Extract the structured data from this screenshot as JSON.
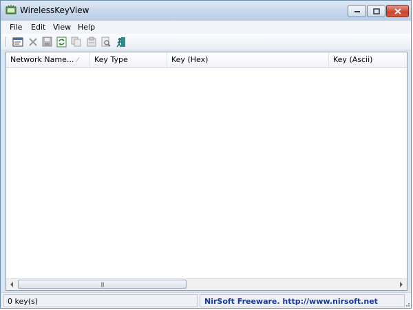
{
  "window": {
    "title": "WirelessKeyView"
  },
  "menu": [
    {
      "label": "File"
    },
    {
      "label": "Edit"
    },
    {
      "label": "View"
    },
    {
      "label": "Help"
    }
  ],
  "toolbar": {
    "icons": [
      "properties-icon",
      "delete-icon",
      "save-icon",
      "refresh-icon",
      "copy-icon",
      "html-report-icon",
      "find-icon",
      "exit-icon"
    ]
  },
  "list": {
    "columns": [
      {
        "label": "Network Name..."
      },
      {
        "label": "Key Type"
      },
      {
        "label": "Key (Hex)"
      },
      {
        "label": "Key (Ascii)"
      }
    ],
    "rows": []
  },
  "status": {
    "count": "0 key(s)",
    "credit": "NirSoft Freeware.  http://www.nirsoft.net"
  }
}
